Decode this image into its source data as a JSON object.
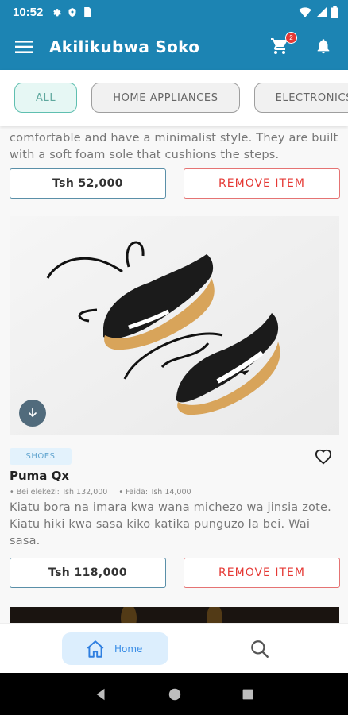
{
  "status_bar": {
    "time": "10:52",
    "left_icons": [
      "gear-icon",
      "shield-icon",
      "sim-card-icon"
    ],
    "right_icons": [
      "wifi-icon",
      "signal-icon",
      "battery-icon"
    ]
  },
  "app_bar": {
    "title": "Akilikubwa Soko",
    "cart_count": "2",
    "icons": [
      "menu-icon",
      "cart-icon",
      "bell-icon"
    ]
  },
  "categories": [
    {
      "label": "ALL",
      "active": true
    },
    {
      "label": "HOME APPLIANCES",
      "active": false
    },
    {
      "label": "ELECTRONICS",
      "active": false
    }
  ],
  "previous_item": {
    "description_tail": "comfortable and have a minimalist style. They are built with a soft foam sole that cushions the steps.",
    "price": "Tsh 52,000",
    "remove_label": "REMOVE ITEM"
  },
  "product": {
    "category_tag": "SHOES",
    "name": "Puma Qx",
    "retail_price": "• Bei elekezi: Tsh 132,000",
    "profit": "• Faida: Tsh 14,000",
    "description": "Kiatu bora na imara kwa wana michezo wa jinsia zote. Kiatu hiki kwa sasa kiko katika punguzo la bei. Wai sasa.",
    "price": "Tsh 118,000",
    "remove_label": "REMOVE ITEM"
  },
  "bottom_nav": {
    "home_label": "Home",
    "icons": [
      "home-icon",
      "search-icon"
    ]
  },
  "colors": {
    "primary": "#1c84b3",
    "accent_teal": "#5fbfb0",
    "remove_red": "#e53935",
    "nav_active_bg": "#dceefd"
  }
}
